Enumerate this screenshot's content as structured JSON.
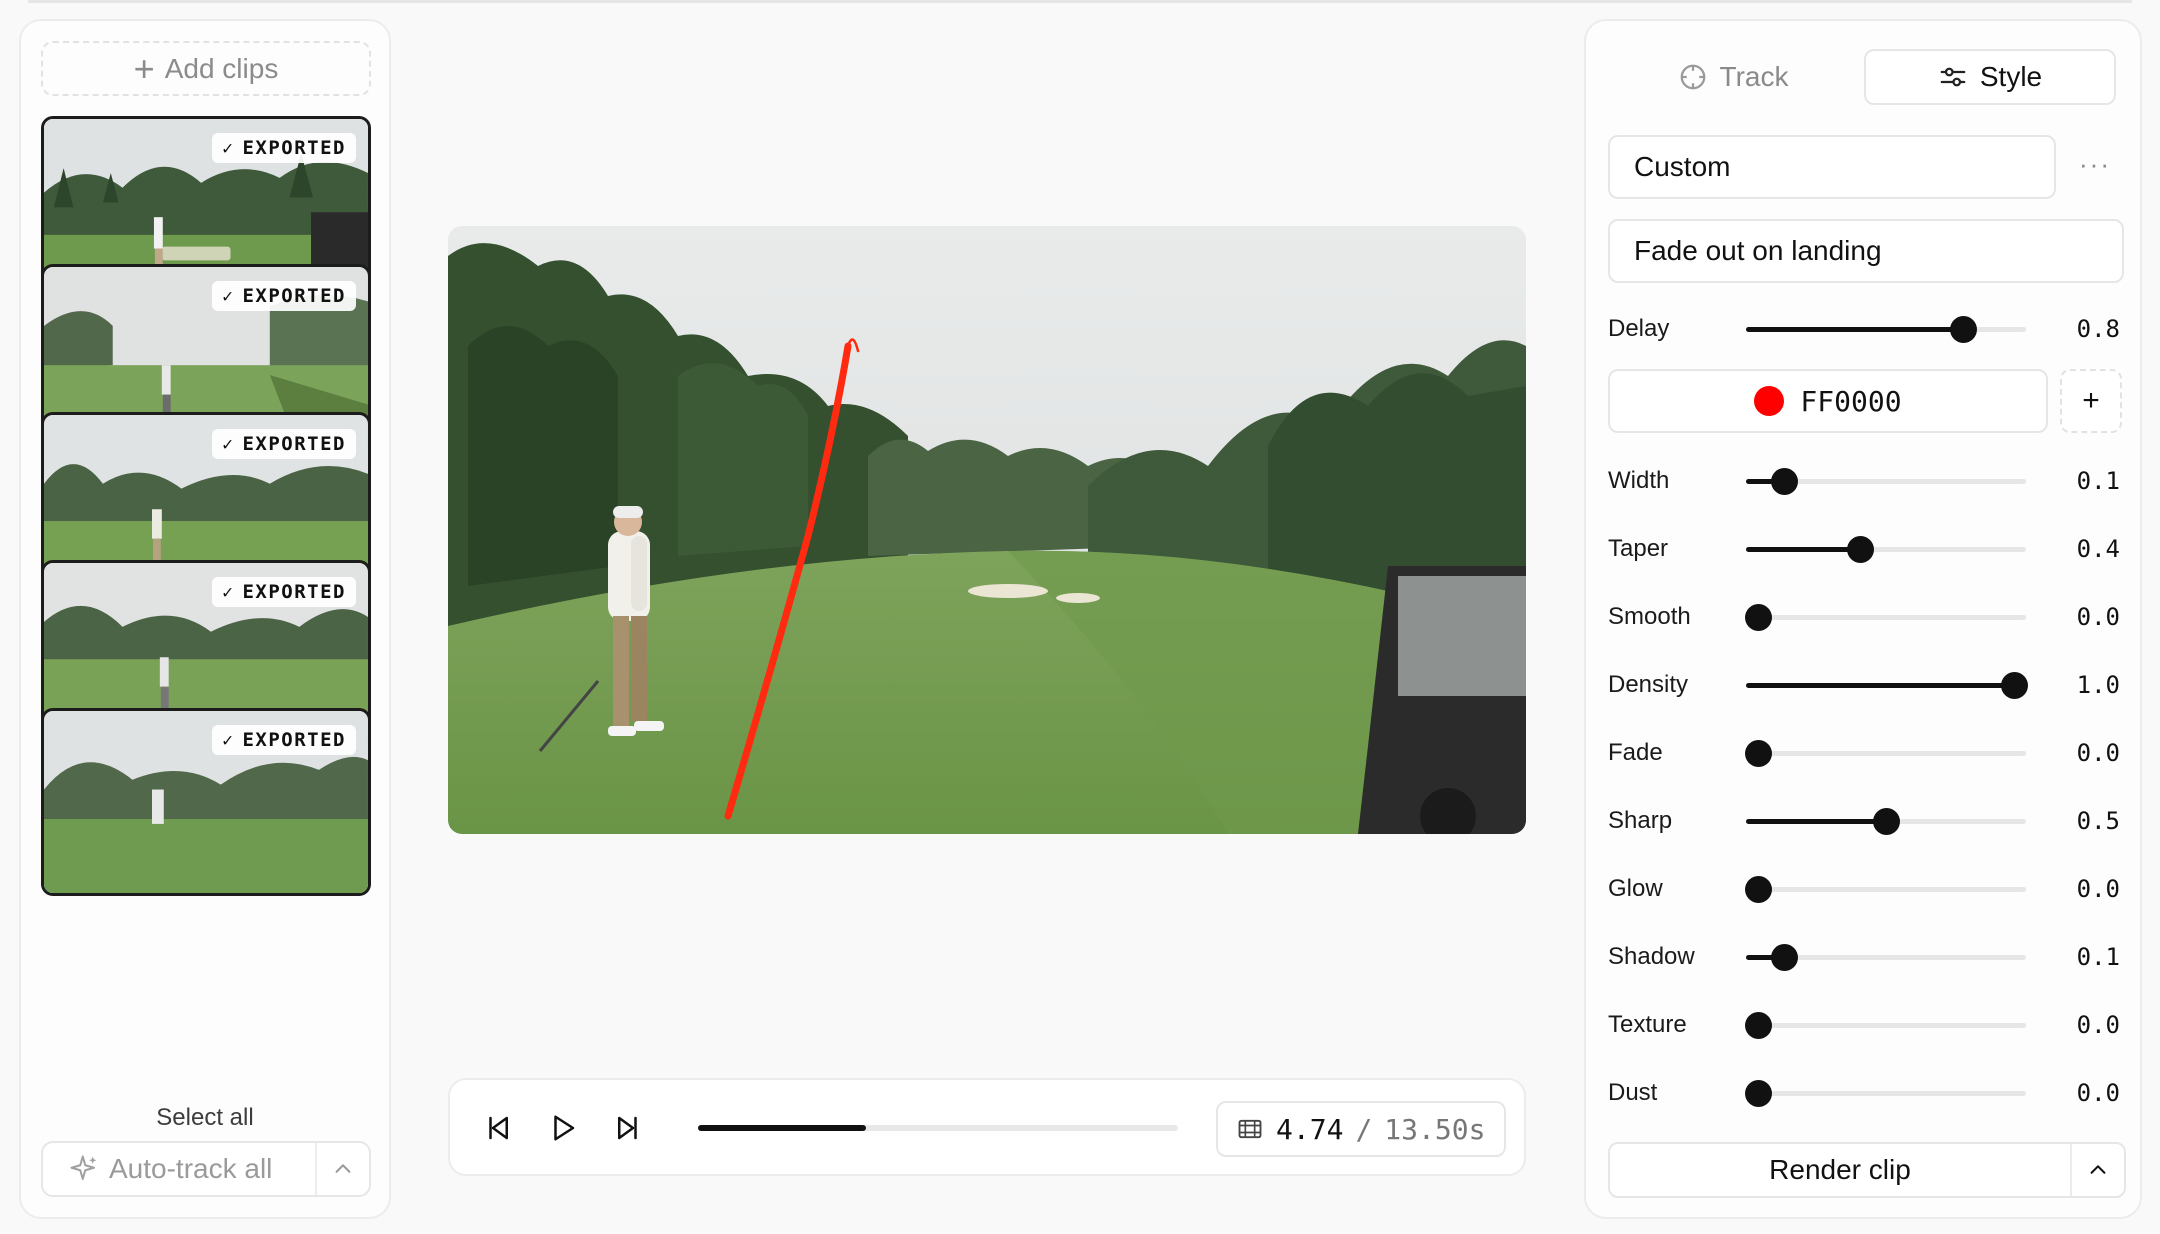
{
  "left_panel": {
    "add_clips_label": "Add clips",
    "clips": [
      {
        "badge": "EXPORTED"
      },
      {
        "badge": "EXPORTED"
      },
      {
        "badge": "EXPORTED"
      },
      {
        "badge": "EXPORTED"
      },
      {
        "badge": "EXPORTED"
      }
    ],
    "select_all_label": "Select all",
    "auto_track_label": "Auto-track all"
  },
  "player": {
    "current_time": "4.74",
    "separator": "/",
    "total_time": "13.50s",
    "progress_fraction": 0.351,
    "trail_color": "#ff2a10"
  },
  "right_panel": {
    "tabs": {
      "track": "Track",
      "style": "Style"
    },
    "active_tab": "style",
    "preset": "Custom",
    "more_label": "···",
    "fade_mode": "Fade out on landing",
    "color_hex": "FF0000",
    "color_value": "#ff0000",
    "add_color_label": "+",
    "delay": {
      "label": "Delay",
      "value": 0.8,
      "display": "0.8"
    },
    "sliders": [
      {
        "label": "Width",
        "value": 0.1,
        "display": "0.1"
      },
      {
        "label": "Taper",
        "value": 0.4,
        "display": "0.4"
      },
      {
        "label": "Smooth",
        "value": 0.0,
        "display": "0.0"
      },
      {
        "label": "Density",
        "value": 1.0,
        "display": "1.0"
      },
      {
        "label": "Fade",
        "value": 0.0,
        "display": "0.0"
      },
      {
        "label": "Sharp",
        "value": 0.5,
        "display": "0.5"
      },
      {
        "label": "Glow",
        "value": 0.0,
        "display": "0.0"
      },
      {
        "label": "Shadow",
        "value": 0.1,
        "display": "0.1"
      },
      {
        "label": "Texture",
        "value": 0.0,
        "display": "0.0"
      },
      {
        "label": "Dust",
        "value": 0.0,
        "display": "0.0"
      }
    ],
    "render_label": "Render clip"
  }
}
